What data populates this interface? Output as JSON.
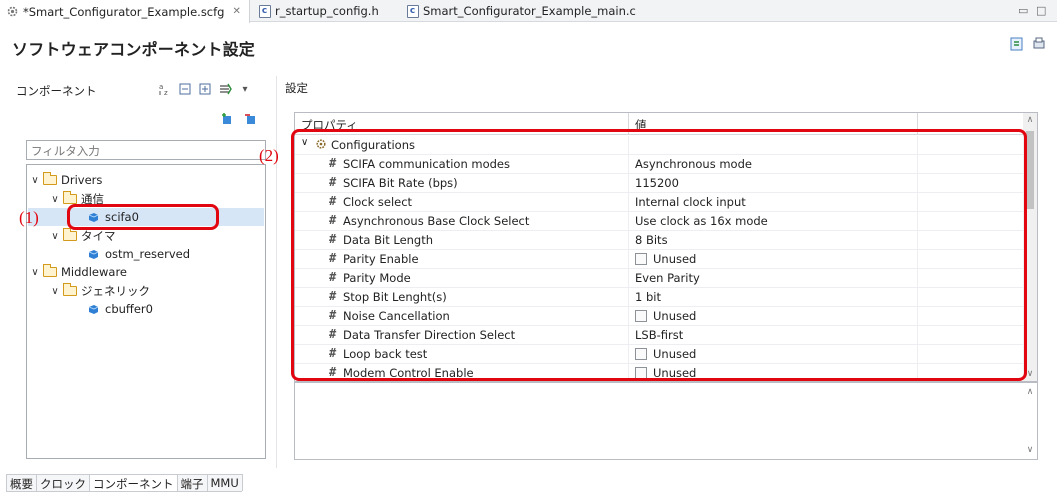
{
  "editor_tabs": [
    {
      "label": "*Smart_Configurator_Example.scfg",
      "icon": "gear-icon",
      "active": true
    },
    {
      "label": "r_startup_config.h",
      "icon": "c-file-icon",
      "active": false
    },
    {
      "label": "Smart_Configurator_Example_main.c",
      "icon": "c-file-icon",
      "active": false
    }
  ],
  "page_title": "ソフトウェアコンポーネント設定",
  "left_panel": {
    "header": "コンポーネント",
    "filter_placeholder": "フィルタ入力",
    "tree": {
      "drivers": "Drivers",
      "comm": "通信",
      "scifa0": "scifa0",
      "timer": "タイマ",
      "ostm": "ostm_reserved",
      "middleware": "Middleware",
      "generic": "ジェネリック",
      "cbuffer": "cbuffer0"
    }
  },
  "right_panel": {
    "header": "設定",
    "col_property": "プロパティ",
    "col_value": "値",
    "group": "Configurations",
    "rows": [
      {
        "name": "SCIFA communication modes",
        "value": "Asynchronous mode"
      },
      {
        "name": "SCIFA Bit Rate (bps)",
        "value": "115200"
      },
      {
        "name": "Clock select",
        "value": "Internal clock input"
      },
      {
        "name": "Asynchronous Base Clock Select",
        "value": "Use clock as 16x mode"
      },
      {
        "name": "Data Bit Length",
        "value": "8 Bits"
      },
      {
        "name": "Parity Enable",
        "value": "Unused"
      },
      {
        "name": "Parity Mode",
        "value": "Even Parity"
      },
      {
        "name": "Stop Bit Lenght(s)",
        "value": "1 bit"
      },
      {
        "name": "Noise Cancellation",
        "value": "Unused"
      },
      {
        "name": "Data Transfer Direction Select",
        "value": "LSB-first"
      },
      {
        "name": "Loop back test",
        "value": "Unused"
      },
      {
        "name": "Modem Control Enable",
        "value": "Unused"
      }
    ]
  },
  "annotations": {
    "one": "(1)",
    "two": "(2)"
  },
  "bottom_tabs": [
    "概要",
    "クロック",
    "コンポーネント",
    "端子",
    "MMU"
  ],
  "colors": {
    "highlight": "#e1060f",
    "selection": "#d7e6f7"
  }
}
